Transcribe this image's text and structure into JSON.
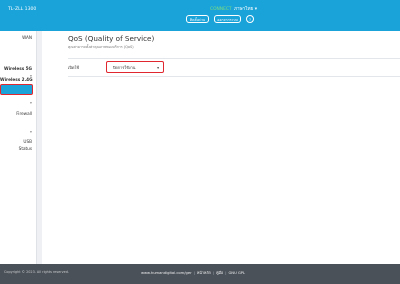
{
  "header": {
    "model_name": "TL-ZLL 1300",
    "status_text": "CONNECT",
    "language": "ภาษาไทย ▾",
    "buttons": [
      "ติดตั้งด่วน",
      "ออกจากระบบ",
      "?"
    ]
  },
  "sidebar": {
    "items": [
      {
        "label": "WAN"
      },
      {
        "label": "Wireless 5G"
      },
      {
        "label": "Wireless 2.4G"
      },
      {
        "label": "QoS"
      },
      {
        "label": "Firewall"
      },
      {
        "label": "USB"
      },
      {
        "label": "Status"
      }
    ],
    "active_index": 3
  },
  "page": {
    "title": "QoS (Quality of Service)",
    "subtitle": "คุณสามารถตั้งค่าคุณภาพของบริการ (QoS)",
    "field_label": "เปิดใช้",
    "select_value": "ปิดการใช้งาน"
  },
  "footer": {
    "copyright": "Copyright © 2023. All rights reserved.",
    "links": [
      "www.humandigital.com/ger",
      "หน้าหลัก",
      "คู่มือ",
      "GNU GPL"
    ]
  },
  "colors": {
    "header": "#1aa3d9",
    "highlight": "#e0262f",
    "footer": "#4b5158"
  }
}
